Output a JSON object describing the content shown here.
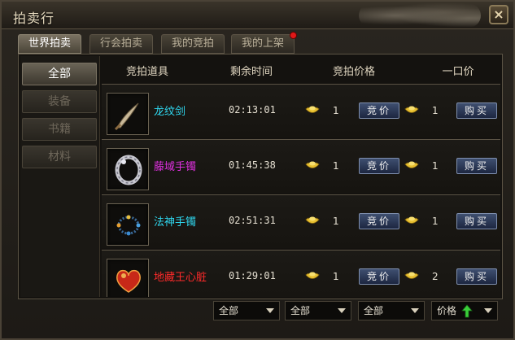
{
  "window": {
    "title": "拍卖行",
    "close_glyph": "×"
  },
  "tabs": [
    {
      "label": "世界拍卖",
      "active": true
    },
    {
      "label": "行会拍卖",
      "active": false
    },
    {
      "label": "我的竞拍",
      "active": false
    },
    {
      "label": "我的上架",
      "active": false,
      "has_notification": true
    }
  ],
  "sidebar": {
    "items": [
      {
        "label": "全部",
        "active": true
      },
      {
        "label": "装备",
        "active": false
      },
      {
        "label": "书籍",
        "active": false
      },
      {
        "label": "材料",
        "active": false
      }
    ]
  },
  "table": {
    "headers": {
      "item": "竞拍道具",
      "time": "剩余时间",
      "bid_price": "竞拍价格",
      "buyout": "一口价"
    },
    "rows": [
      {
        "name": "龙纹剑",
        "name_color": "#2fd8f0",
        "icon": "sword-icon",
        "time": "02:13:01",
        "bid": "1",
        "bid_button": "竞价",
        "buyout": "1",
        "buy_button": "购买"
      },
      {
        "name": "藤域手镯",
        "name_color": "#e030e0",
        "icon": "bracelet-icon",
        "time": "01:45:38",
        "bid": "1",
        "bid_button": "竞价",
        "buyout": "1",
        "buy_button": "购买"
      },
      {
        "name": "法神手镯",
        "name_color": "#2fd8f0",
        "icon": "bead-bracelet-icon",
        "time": "02:51:31",
        "bid": "1",
        "bid_button": "竞价",
        "buyout": "1",
        "buy_button": "购买"
      },
      {
        "name": "地藏王心脏",
        "name_color": "#ff2a2a",
        "icon": "heart-icon",
        "time": "01:29:01",
        "bid": "1",
        "bid_button": "竞价",
        "buyout": "2",
        "buy_button": "购买"
      }
    ]
  },
  "filters": [
    {
      "value": "全部"
    },
    {
      "value": "全部"
    },
    {
      "value": "全部"
    },
    {
      "value": "价格",
      "sort_icon": "up-arrow-icon"
    }
  ],
  "colors": {
    "gold": "#e8c030",
    "up_arrow": "#3ad03a",
    "notification": "#e01818"
  }
}
